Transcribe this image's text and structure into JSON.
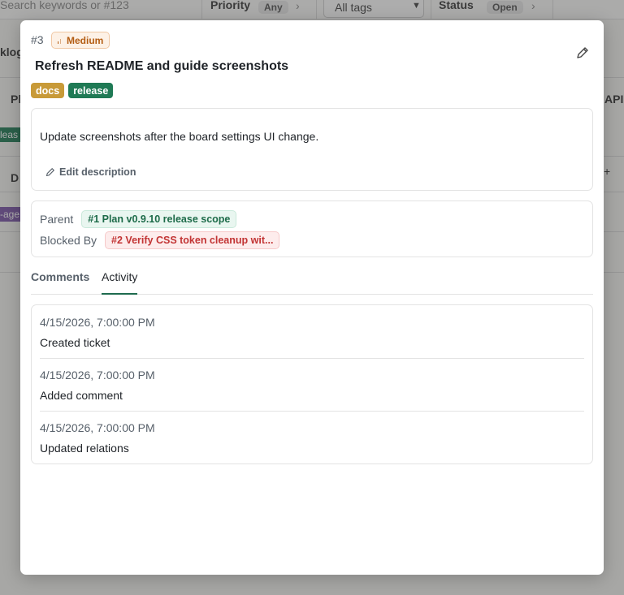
{
  "background": {
    "search_placeholder": "Search keywords or #123",
    "priority_label": "Priority",
    "priority_value": "Any",
    "tags_value": "All tags",
    "status_label": "Status",
    "status_value": "Open",
    "col_left_1": "klog",
    "col_left_2": "Pl",
    "col_left_3": "D",
    "chip_left_1": "leas",
    "chip_left_2": "-age",
    "col_right": "API",
    "plus": "+"
  },
  "ticket": {
    "id": "#3",
    "priority": "Medium",
    "title": "Refresh README and guide screenshots",
    "tags": [
      {
        "label": "docs",
        "color": "#c89a38"
      },
      {
        "label": "release",
        "color": "#1f7a55"
      }
    ],
    "description": "Update screenshots after the board settings UI change.",
    "edit_description_label": "Edit description",
    "relations": {
      "parent_label": "Parent",
      "parent_value": "#1 Plan v0.9.10 release scope",
      "blocked_label": "Blocked By",
      "blocked_value": "#2 Verify CSS token cleanup wit..."
    },
    "tabs": [
      "Comments",
      "Activity"
    ],
    "active_tab": "Activity",
    "activity": [
      {
        "time": "4/15/2026, 7:00:00 PM",
        "text": "Created ticket"
      },
      {
        "time": "4/15/2026, 7:00:00 PM",
        "text": "Added comment"
      },
      {
        "time": "4/15/2026, 7:00:00 PM",
        "text": "Updated relations"
      }
    ]
  },
  "colors": {
    "accent": "#1f6b4f",
    "priority_medium": "#b35c12",
    "blocked": "#c23434"
  }
}
